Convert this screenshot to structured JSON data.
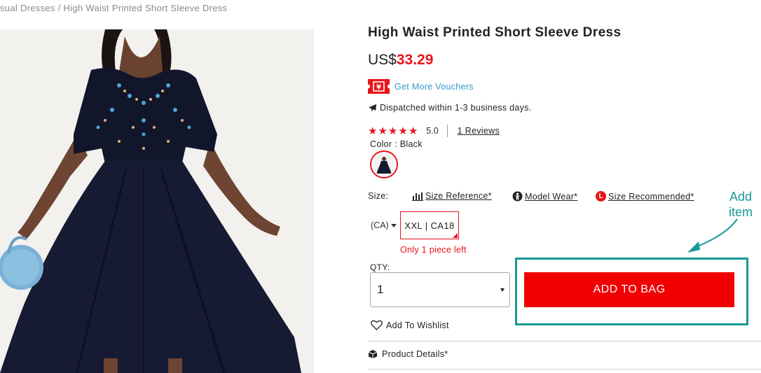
{
  "breadcrumb": {
    "text": "sual Dresses / High Waist Printed Short Sleeve Dress"
  },
  "product": {
    "title": "High Waist Printed Short Sleeve Dress",
    "currency": "US$",
    "price": "33.29",
    "voucher_link": "Get More Vouchers",
    "voucher_icon": "voucher-ticket-icon",
    "dispatch_text": "Dispatched within 1-3 business days.",
    "dispatch_icon": "plane-icon",
    "rating": {
      "stars": 5,
      "max": 5,
      "score": "5.0",
      "reviews_link": "1 Reviews"
    },
    "color": {
      "label": "Color : Black"
    }
  },
  "size": {
    "label": "Size:",
    "links": {
      "reference": "Size Reference*",
      "model_wear": "Model Wear*",
      "recommended_badge": "L",
      "recommended": "Size Recommended*"
    },
    "region": "(CA)",
    "selected": "XXL | CA18",
    "stock_note": "Only 1 piece left"
  },
  "quantity": {
    "label": "QTY:",
    "value": "1"
  },
  "cart": {
    "add_label": "ADD TO BAG"
  },
  "annotation": {
    "line1": "Add",
    "line2": "item"
  },
  "wishlist": {
    "label": "Add To Wishlist"
  },
  "details": {
    "label": "Product Details*"
  },
  "colors": {
    "accent_red": "#e8141a",
    "button_red": "#f00000",
    "annotation_teal": "#1a9a96",
    "link_blue": "#3399cc"
  }
}
